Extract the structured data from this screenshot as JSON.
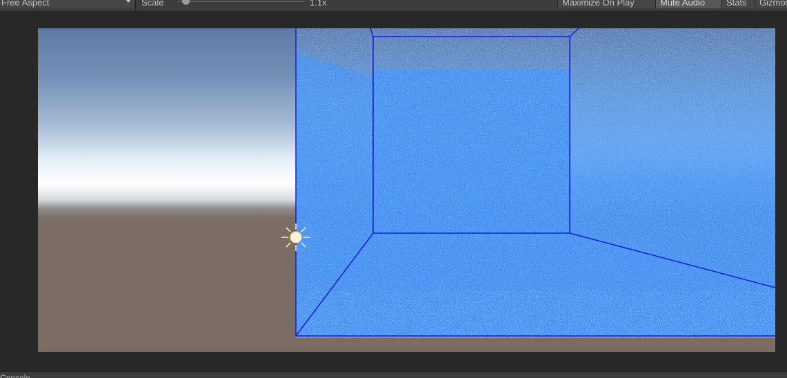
{
  "toolbar": {
    "aspect_label": "Free Aspect",
    "scale_label": "Scale",
    "scale_value": "1.1x",
    "scale_level": 0.1,
    "maximize_label": "Maximize On Play",
    "mute_label": "Mute Audio",
    "stats_label": "Stats",
    "gizmos_label": "Gizmos"
  },
  "viewport": {
    "fluid_color": "#4390f2",
    "box_line_color": "#1a1ad8",
    "ground_color": "#7a6d63",
    "sky_top_color": "#5d7aa6",
    "light_icon": "sun-icon"
  },
  "statusbar": {
    "text": "Console"
  }
}
